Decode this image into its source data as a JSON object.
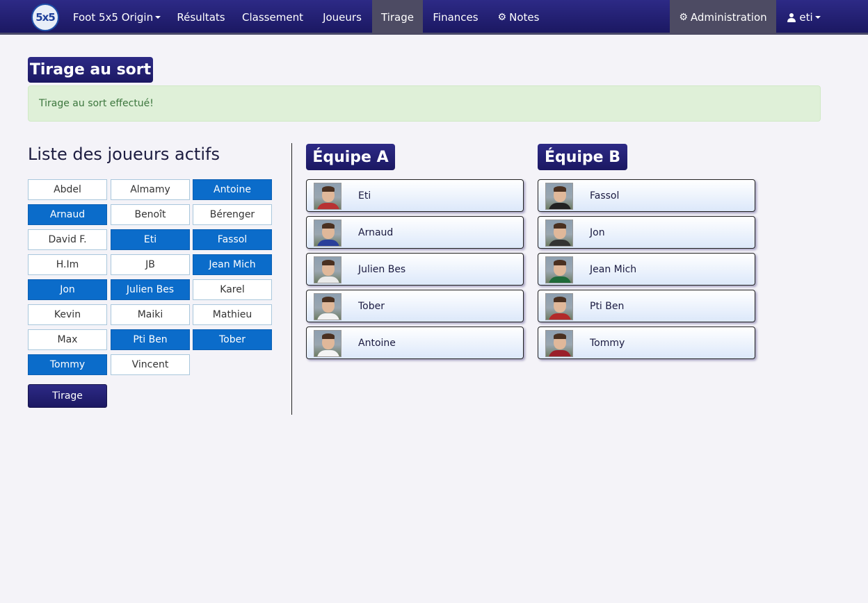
{
  "navbar": {
    "logo_text": "5x5",
    "brand_label": "Foot 5x5 Origin",
    "items": [
      {
        "label": "Résultats"
      },
      {
        "label": "Classement"
      },
      {
        "label": "Joueurs"
      },
      {
        "label": "Tirage",
        "active": true
      },
      {
        "label": "Finances"
      },
      {
        "label": "Notes",
        "icon": "gear-icon"
      }
    ],
    "admin": {
      "label": "Administration",
      "icon": "gear-icon"
    },
    "user": {
      "label": "eti",
      "icon": "user-icon"
    }
  },
  "page": {
    "title": "Tirage au sort",
    "alert": "Tirage au sort effectué!"
  },
  "players": {
    "heading": "Liste des joueurs actifs",
    "list": [
      {
        "name": "Abdel",
        "selected": false
      },
      {
        "name": "Almamy",
        "selected": false
      },
      {
        "name": "Antoine",
        "selected": true
      },
      {
        "name": "Arnaud",
        "selected": true
      },
      {
        "name": "Benoît",
        "selected": false
      },
      {
        "name": "Bérenger",
        "selected": false
      },
      {
        "name": "David F.",
        "selected": false
      },
      {
        "name": "Eti",
        "selected": true
      },
      {
        "name": "Fassol",
        "selected": true
      },
      {
        "name": "H.Im",
        "selected": false
      },
      {
        "name": "JB",
        "selected": false
      },
      {
        "name": "Jean Mich",
        "selected": true
      },
      {
        "name": "Jon",
        "selected": true
      },
      {
        "name": "Julien Bes",
        "selected": true
      },
      {
        "name": "Karel",
        "selected": false
      },
      {
        "name": "Kevin",
        "selected": false
      },
      {
        "name": "Maiki",
        "selected": false
      },
      {
        "name": "Mathieu",
        "selected": false
      },
      {
        "name": "Max",
        "selected": false
      },
      {
        "name": "Pti Ben",
        "selected": true
      },
      {
        "name": "Tober",
        "selected": true
      },
      {
        "name": "Tommy",
        "selected": true
      },
      {
        "name": "Vincent",
        "selected": false
      }
    ],
    "draw_button": "Tirage"
  },
  "teams": {
    "a": {
      "title": "Équipe A",
      "players": [
        "Eti",
        "Arnaud",
        "Julien Bes",
        "Tober",
        "Antoine"
      ]
    },
    "b": {
      "title": "Équipe B",
      "players": [
        "Fassol",
        "Jon",
        "Jean Mich",
        "Pti Ben",
        "Tommy"
      ]
    }
  },
  "colors": {
    "nav_bg": "#231f78",
    "selected": "#0b6cca",
    "alert_bg": "#dff0d8"
  }
}
